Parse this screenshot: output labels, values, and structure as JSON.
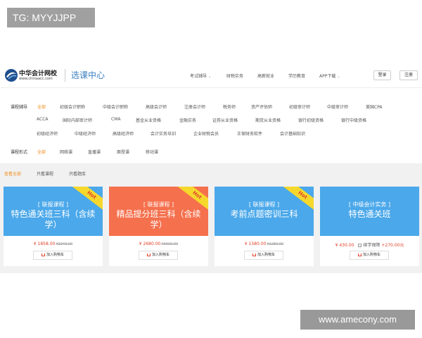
{
  "badge": "TG: MYYJJPP",
  "logo": {
    "cn": "中华会计网校",
    "en": "www.chinaacc.com"
  },
  "section_title": "选课中心",
  "topnav": [
    "考试辅导",
    "财税实务",
    "高薪就业",
    "学历教育",
    "APP下载"
  ],
  "buttons": {
    "login": "登录",
    "register": "注册"
  },
  "filters": {
    "exam_label": "课程辅导",
    "all": "全部",
    "row1": [
      "初级会计职称",
      "中级会计职称",
      "高级会计师",
      "注册会计师",
      "税务师",
      "资产评估师",
      "初级审计师",
      "中级审计师",
      "美国CPA"
    ],
    "row2": [
      "ACCA",
      "国际内部审计师",
      "CMA",
      "基金从业资格",
      "金融实务",
      "证券从业资格",
      "期货从业资格",
      "银行初级资格",
      "银行中级资格"
    ],
    "row3": [
      "初级经济师",
      "中级经济师",
      "高级经济师",
      "会计实务培训",
      "企业财税会员",
      "正保财务软件",
      "会计基础知识"
    ],
    "format_label": "课程形式",
    "format_all": "全部",
    "formats": [
      "网络课",
      "直播课",
      "面授课",
      "移动课"
    ]
  },
  "subtabs": [
    "查看全部",
    "只看课程",
    "只看题库"
  ],
  "cards": [
    {
      "tag": "[ 联报课程 ]",
      "name": "特色通关班三科（含续学）",
      "hot": "Hot",
      "price": "¥ 1858.00",
      "old_price": "¥2940.00",
      "add": "加入购物车",
      "color": "#4ba8ea"
    },
    {
      "tag": "[ 联报课程 ]",
      "name": "精品提分班三科（含续学）",
      "hot": "Hot",
      "price": "¥ 2680.00",
      "old_price": "¥3600.00",
      "add": "加入购物车",
      "color": "#f5704d"
    },
    {
      "tag": "[ 联报课程 ]",
      "name": "考前点题密训三科",
      "hot": "Hot",
      "price": "¥ 1580.00",
      "old_price": "¥2280.00",
      "add": "加入购物车",
      "color": "#4ba8ea"
    },
    {
      "tag": "[ 中级会计实务 ]",
      "name": "特色通关班",
      "price": "¥ 430.00",
      "addon": "续学保障",
      "addon_price": "+270.00元",
      "add": "加入购物车",
      "color": "#4ba8ea"
    }
  ],
  "watermark": "www.amecony.com"
}
